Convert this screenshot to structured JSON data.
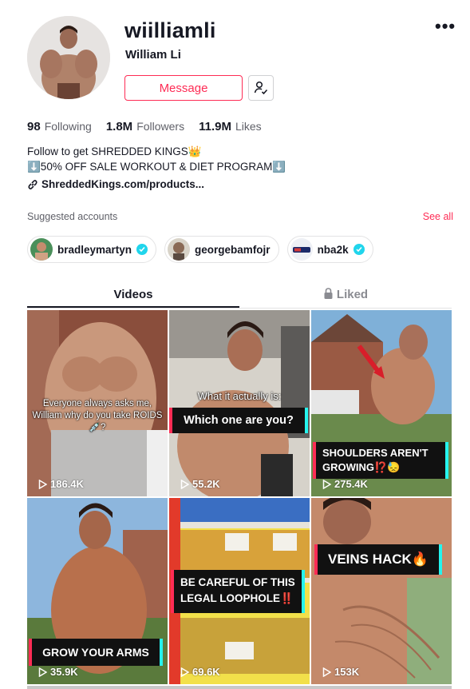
{
  "profile": {
    "username": "wiilliamli",
    "nickname": "William Li",
    "more_label": "•••",
    "message_label": "Message",
    "stats": [
      {
        "value": "98",
        "label": "Following"
      },
      {
        "value": "1.8M",
        "label": "Followers"
      },
      {
        "value": "11.9M",
        "label": "Likes"
      }
    ],
    "bio_line1": "Follow to get SHREDDED KINGS👑",
    "bio_line2": "⬇️50% OFF SALE WORKOUT & DIET PROGRAM⬇️",
    "link": "ShreddedKings.com/products..."
  },
  "suggested": {
    "title": "Suggested accounts",
    "see_all": "See all",
    "accounts": [
      {
        "name": "bradleymartyn"
      },
      {
        "name": "georgebamfojr"
      },
      {
        "name": "nba2k"
      }
    ]
  },
  "tabs": {
    "videos": "Videos",
    "liked": "Liked"
  },
  "videos": [
    {
      "views": "186.4K",
      "caption": "Everyone always asks me, William why do you take ROIDS💉?"
    },
    {
      "views": "55.2K",
      "caption_top": "What it actually is:",
      "caption": "Which one are you?"
    },
    {
      "views": "275.4K",
      "caption": "SHOULDERS AREN'T GROWING⁉️😓"
    },
    {
      "views": "35.9K",
      "caption": "GROW YOUR ARMS"
    },
    {
      "views": "69.6K",
      "caption": "BE CAREFUL OF THIS LEGAL LOOPHOLE‼️"
    },
    {
      "views": "153K",
      "caption": "VEINS HACK🔥"
    }
  ],
  "colors": {
    "accent": "#fe2c55",
    "verified": "#20d5ec",
    "banner_cyan": "#25f4ee"
  }
}
